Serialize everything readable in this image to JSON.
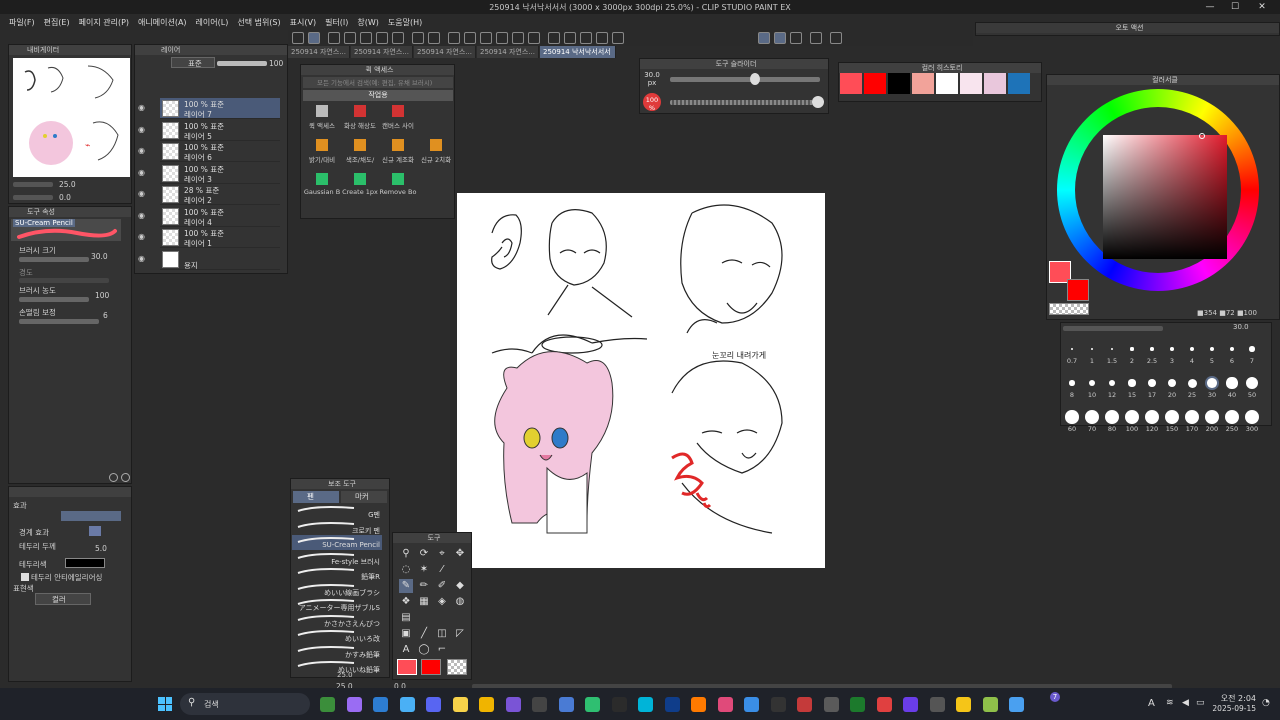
{
  "window": {
    "title": "250914 낙서낙서서서 (3000 x 3000px 300dpi 25.0%) - CLIP STUDIO PAINT EX",
    "minimize": "—",
    "maximize": "☐",
    "close": "✕"
  },
  "menu": [
    "파일(F)",
    "편집(E)",
    "페이지 관리(P)",
    "애니메이션(A)",
    "레이어(L)",
    "선택 범위(S)",
    "표시(V)",
    "필터(I)",
    "창(W)",
    "도움말(H)"
  ],
  "document_tabs": [
    "250914 자연스...",
    "250914 자연스...",
    "250914 자연스...",
    "250914 자연스...",
    "250914 낙서낙서서서"
  ],
  "navigator": {
    "tab_label": "내비게이터",
    "zoom": "25.0",
    "rotate": "0.0"
  },
  "layers": {
    "tab_label": "레이어",
    "blend_mode": "표준",
    "opacity": "100",
    "items": [
      {
        "line1": "100 % 표준",
        "line2": "레이어 7",
        "selected": true
      },
      {
        "line1": "100 % 표준",
        "line2": "레이어 5",
        "selected": false
      },
      {
        "line1": "100 % 표준",
        "line2": "레이어 6",
        "selected": false
      },
      {
        "line1": "100 % 표준",
        "line2": "레이어 3",
        "selected": false
      },
      {
        "line1": "28 % 표준",
        "line2": "레이어 2",
        "selected": false
      },
      {
        "line1": "100 % 표준",
        "line2": "레이어 4",
        "selected": false
      },
      {
        "line1": "100 % 표준",
        "line2": "레이어 1",
        "selected": false
      },
      {
        "line1": "",
        "line2": "용지",
        "selected": false
      }
    ]
  },
  "tool_property": {
    "title": "도구 속성",
    "brush_name": "SU-Cream Pencil",
    "brush_size_label": "브러시 크기",
    "brush_size": "30.0",
    "hardness_label": "경도",
    "density_label": "브러시 농도",
    "density": "100",
    "stabilization_label": "손떨림 보정",
    "stabilization": "6"
  },
  "sub_property": {
    "effect_label": "효과",
    "border_effect_label": "경계 효과",
    "border_width_label": "테두리 두께",
    "border_width": "5.0",
    "border_color_label": "테두리색",
    "antialias_label": "테두리 안티에일리어싱",
    "expression_label": "표현색",
    "expression_value": "컬러"
  },
  "quick_access": {
    "title": "퀵 액세스",
    "search_placeholder": "모든 기능에서 검색(예: 편집, 유채 브러시)",
    "set_name": "작업용",
    "buttons": [
      {
        "label": "퀵 액세스",
        "color": "#bbbbbb"
      },
      {
        "label": "화상 해상도",
        "color": "#d33333"
      },
      {
        "label": "캔버스 사이",
        "color": "#d33333"
      },
      {
        "label": "밝기/대비",
        "color": "#e09020"
      },
      {
        "label": "색조/채도/",
        "color": "#e09020"
      },
      {
        "label": "신규 계조화",
        "color": "#e09020"
      },
      {
        "label": "신규 2치화",
        "color": "#e09020"
      },
      {
        "label": "Gaussian B",
        "color": "#2bbf6a"
      },
      {
        "label": "Create 1px",
        "color": "#2bbf6a"
      },
      {
        "label": "Remove Bo",
        "color": "#2bbf6a"
      }
    ]
  },
  "tool_slider": {
    "title": "도구 슬라이더",
    "size": "30.0",
    "size_unit": "px",
    "opacity": "100",
    "opacity_unit": "%"
  },
  "color_history": {
    "title": "컬러 히스토리",
    "colors": [
      "#ff4d57",
      "#ff0000",
      "#000000",
      "#f2a39a",
      "#ffffff",
      "#f8e4ee",
      "#e9c7dc",
      "#1e73b8"
    ]
  },
  "color_wheel": {
    "title": "컬러서클",
    "main_color": "#ff4d57",
    "sub_color": "#ff0000",
    "hsv_readout": "■354 ■72 ■100"
  },
  "auto_action": {
    "title": "오토 액션"
  },
  "brush_size_palette": {
    "current": "30.0",
    "sizes": [
      "0.7",
      "1",
      "1.5",
      "2",
      "2.5",
      "3",
      "4",
      "5",
      "6",
      "7",
      "8",
      "10",
      "12",
      "15",
      "17",
      "20",
      "25",
      "30",
      "40",
      "50",
      "60",
      "70",
      "80",
      "100",
      "120",
      "150",
      "170",
      "200",
      "250",
      "300"
    ]
  },
  "sub_tool": {
    "title": "보조 도구",
    "tabs": [
      "펜",
      "마커"
    ],
    "brushes": [
      "G펜",
      "크로키 펜",
      "SU-Cream Pencil",
      "Fe-style 브러시",
      "鉛筆R",
      "めいい線画ブラシ",
      "アニメーター専用ザブルS",
      "かさかさえんぴつ",
      "めいいろ改",
      "かすみ鉛筆",
      "めいいね鉛筆"
    ],
    "size_footer": "25.0"
  },
  "tool_panel": {
    "title": "도구"
  },
  "canvas": {
    "annotation": "눈꼬리 내려가게"
  },
  "footer": {
    "zoom": "25.0",
    "rotate": "0.0"
  },
  "taskbar": {
    "search_placeholder": "검색",
    "time": "오전 2:04",
    "date": "2025-09-15",
    "lang": "A",
    "notification_badge": "7"
  }
}
